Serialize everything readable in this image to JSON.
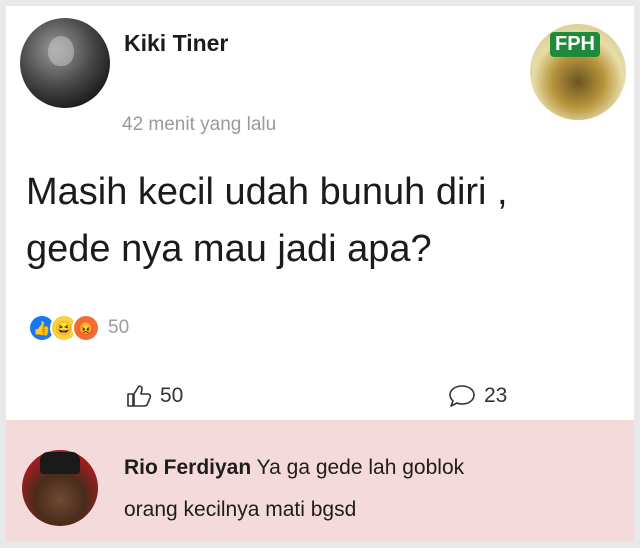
{
  "post": {
    "author": "Kiki Tiner",
    "time": "42 menit yang lalu",
    "badge": "FPH",
    "text_line1": "Masih kecil udah bunuh diri ,",
    "text_line2": "gede nya mau jadi apa?",
    "reaction_count": "50",
    "reaction_icons": [
      "like-icon",
      "haha-icon",
      "angry-icon"
    ],
    "like_count": "50",
    "comment_count": "23"
  },
  "comment": {
    "author": "Rio Ferdiyan",
    "text_line1": "Ya ga gede lah goblok",
    "text_line2": "orang kecilnya mati bgsd"
  },
  "colors": {
    "comment_background": "#f4dada",
    "like_reaction": "#1877f2",
    "haha_reaction": "#f7d13e",
    "angry_reaction": "#f06d3a",
    "badge_green": "#1f8a3a"
  }
}
